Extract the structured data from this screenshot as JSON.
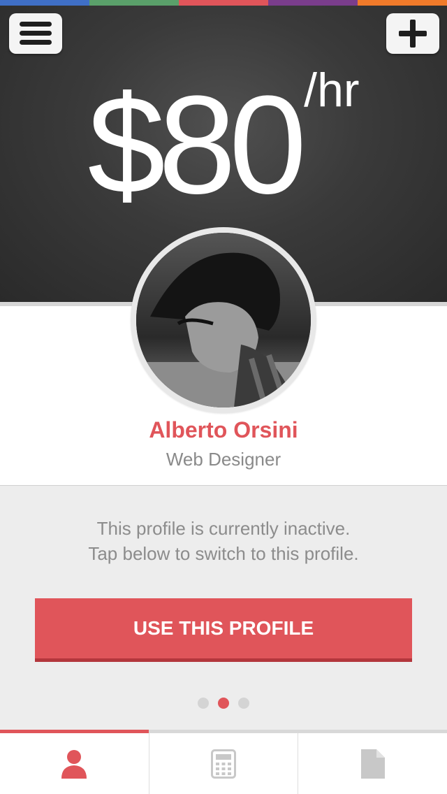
{
  "colors": {
    "accent": "#e0555a",
    "top_strip": [
      "#3f6fc6",
      "#5aa06a",
      "#e0555a",
      "#7a3d8c",
      "#f07a2a"
    ]
  },
  "header": {
    "menu_icon": "hamburger-menu-icon",
    "add_icon": "plus-icon",
    "rate_amount": "$80",
    "rate_unit": "/hr"
  },
  "profile": {
    "name": "Alberto Orsini",
    "role": "Web Designer",
    "avatar_icon": "profile-photo"
  },
  "status": {
    "line1": "This profile is currently inactive.",
    "line2": "Tap below to switch to this profile."
  },
  "actions": {
    "use_profile_label": "USE THIS PROFILE"
  },
  "pagination": {
    "total": 3,
    "active": 2
  },
  "tabbar": {
    "tabs": [
      {
        "icon": "person-icon",
        "active": true
      },
      {
        "icon": "calculator-icon",
        "active": false
      },
      {
        "icon": "document-icon",
        "active": false
      }
    ]
  }
}
